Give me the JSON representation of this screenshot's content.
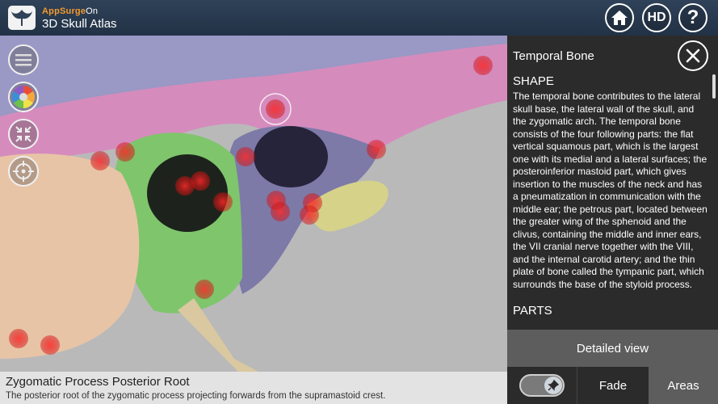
{
  "header": {
    "brand_prefix": "AppSurge",
    "brand_suffix": "On",
    "app_title": "3D Skull Atlas",
    "hd_label": "HD",
    "help_label": "?"
  },
  "panel": {
    "title": "Temporal Bone",
    "sections": [
      {
        "heading": "SHAPE",
        "body": "The temporal bone contributes to the lateral skull base, the lateral wall of the skull, and the zygomatic arch. The temporal bone consists of the four following parts: the flat vertical squamous part, which is the largest one with its medial and a lateral surfaces; the posteroinferior mastoid part, which gives insertion to the muscles of the neck and has a pneumatization in communication with the middle ear; the petrous part, located between the greater wing of the sphenoid and the clivus, containing the middle and inner ears, the VII cranial nerve together with the VIII, and the internal carotid artery; and the thin plate of bone called the tympanic part, which surrounds the base of the styloid process."
      },
      {
        "heading": "PARTS",
        "body": ""
      }
    ],
    "detailed_view_label": "Detailed view",
    "fade_label": "Fade",
    "areas_label": "Areas"
  },
  "caption": {
    "title": "Zygomatic Process Posterior Root",
    "description": "The posterior root of the zygomatic process projecting forwards from the supramastoid crest."
  },
  "icons": {
    "home": "home-icon",
    "close": "close-icon",
    "menu": "menu-icon",
    "color": "color-wheel-icon",
    "fit": "collapse-arrows-icon",
    "target": "crosshair-icon",
    "pin": "pin-icon"
  },
  "colors": {
    "header_bg": "#2a3b50",
    "brand_orange": "#f39a2e",
    "panel_bg": "#2b2b2b",
    "button_gray": "#5d5d5d",
    "bone_pink": "#d98fbf",
    "bone_green": "#7cc46a",
    "bone_purple": "#8e86b8",
    "marker_red": "#e02020"
  }
}
